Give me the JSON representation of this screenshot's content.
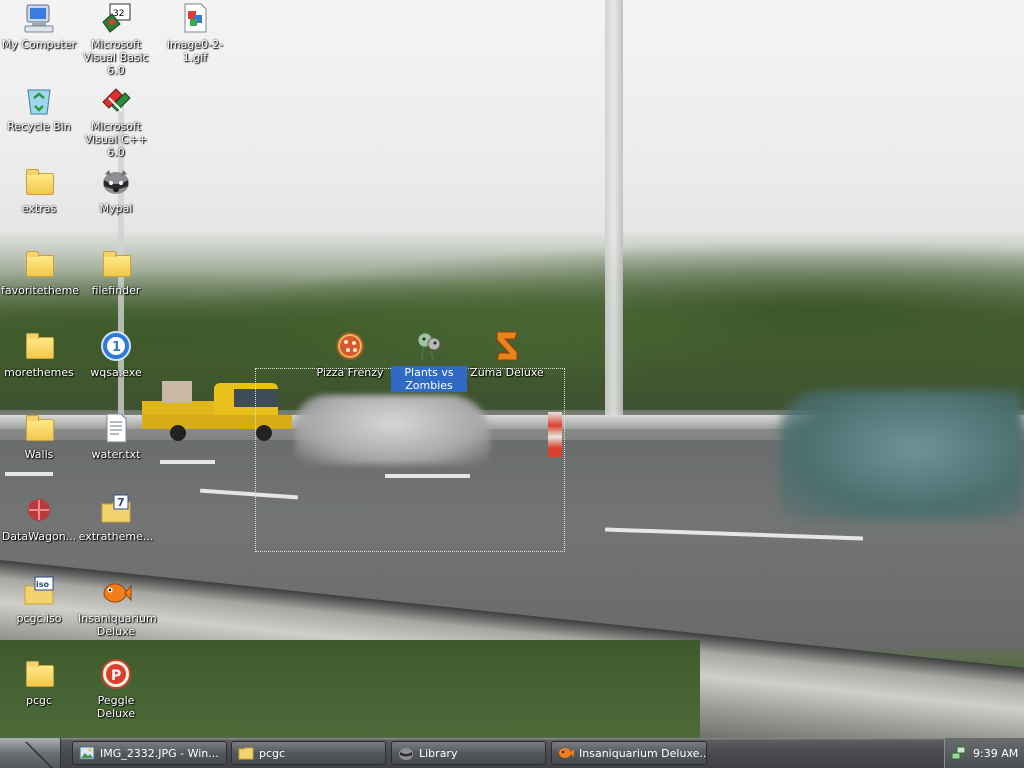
{
  "desktop": {
    "icons": [
      {
        "name": "my-computer",
        "label": "My Computer",
        "icon": "computer-icon"
      },
      {
        "name": "vb6",
        "label": "Microsoft Visual Basic 6.0",
        "icon": "visual-basic-icon"
      },
      {
        "name": "image-gif",
        "label": "image0-2-1.gif",
        "icon": "gif-image-icon"
      },
      {
        "name": "recycle-bin",
        "label": "Recycle Bin",
        "icon": "recycle-bin-icon"
      },
      {
        "name": "vcpp6",
        "label": "Microsoft Visual C++ 6.0",
        "icon": "visual-cpp-icon"
      },
      {
        "name": "extras",
        "label": "extras",
        "icon": "folder-icon"
      },
      {
        "name": "mypal",
        "label": "Mypal",
        "icon": "raccoon-icon"
      },
      {
        "name": "favoritetheme",
        "label": "favoritetheme",
        "icon": "folder-icon"
      },
      {
        "name": "filefinder",
        "label": "filefinder",
        "icon": "folder-icon"
      },
      {
        "name": "morethemes",
        "label": "morethemes",
        "icon": "folder-icon"
      },
      {
        "name": "wqsa",
        "label": "wqsa.exe",
        "icon": "exe-blue-circle-icon"
      },
      {
        "name": "pizza-frenzy",
        "label": "Pizza Frenzy",
        "icon": "pizza-icon"
      },
      {
        "name": "pvz",
        "label": "Plants vs Zombies",
        "icon": "plants-vs-zombies-icon"
      },
      {
        "name": "zuma",
        "label": "Zuma Deluxe",
        "icon": "zuma-icon"
      },
      {
        "name": "walls",
        "label": "Walls",
        "icon": "folder-icon"
      },
      {
        "name": "water-txt",
        "label": "water.txt",
        "icon": "text-file-icon"
      },
      {
        "name": "datawagon",
        "label": "DataWagon...",
        "icon": "datawagon-icon"
      },
      {
        "name": "extratheme",
        "label": "extratheme...",
        "icon": "zip-folder-icon"
      },
      {
        "name": "pcgc-iso",
        "label": "pcgc.iso",
        "icon": "iso-file-icon"
      },
      {
        "name": "insaniquarium",
        "label": "Insaniquarium Deluxe",
        "icon": "goldfish-icon"
      },
      {
        "name": "pcgc",
        "label": "pcgc",
        "icon": "folder-icon"
      },
      {
        "name": "peggle",
        "label": "Peggle Deluxe",
        "icon": "peggle-icon"
      }
    ],
    "selected_icon": "Plants vs Zombies"
  },
  "taskbar": {
    "tasks": [
      {
        "label": "IMG_2332.JPG - Win...",
        "icon": "image-viewer-icon"
      },
      {
        "label": "pcgc",
        "icon": "folder-icon"
      },
      {
        "label": "Library",
        "icon": "raccoon-icon"
      },
      {
        "label": "Insaniquarium Deluxe...",
        "icon": "goldfish-icon"
      }
    ],
    "tray_icon": "network-icon",
    "clock": "9:39 AM"
  }
}
